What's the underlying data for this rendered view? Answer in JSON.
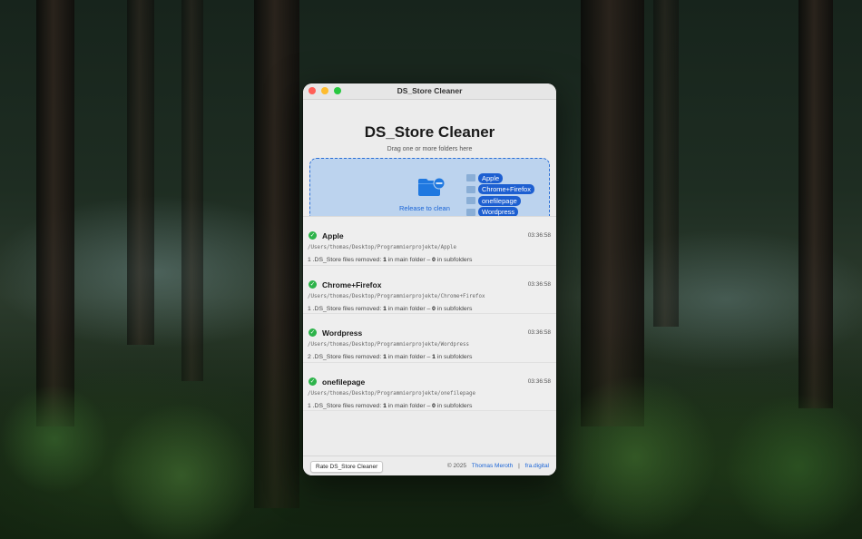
{
  "window": {
    "title": "DS_Store Cleaner"
  },
  "header": {
    "title": "DS_Store Cleaner",
    "drag_hint": "Drag one or more folders here"
  },
  "dropzone": {
    "release_label": "Release to clean",
    "dragged_items": [
      "Apple",
      "Chrome+Firefox",
      "onefilepage",
      "Wordpress"
    ],
    "badge_count": "4"
  },
  "results": [
    {
      "name": "Apple",
      "time": "03:36:58",
      "path": "/Users/thomas/Desktop/Programmierprojekte/Apple",
      "total": "1",
      "main": "1",
      "sub": "0"
    },
    {
      "name": "Chrome+Firefox",
      "time": "03:36:58",
      "path": "/Users/thomas/Desktop/Programmierprojekte/Chrome+Firefox",
      "total": "1",
      "main": "1",
      "sub": "0"
    },
    {
      "name": "Wordpress",
      "time": "03:36:58",
      "path": "/Users/thomas/Desktop/Programmierprojekte/Wordpress",
      "total": "2",
      "main": "1",
      "sub": "1"
    },
    {
      "name": "onefilepage",
      "time": "03:36:58",
      "path": "/Users/thomas/Desktop/Programmierprojekte/onefilepage",
      "total": "1",
      "main": "1",
      "sub": "0"
    }
  ],
  "summary_text": {
    "files_removed": " .DS_Store files removed: ",
    "in_main": " in main folder – ",
    "in_sub": " in subfolders"
  },
  "footer": {
    "rate_button": "Rate DS_Store Cleaner",
    "copyright": "© 2025",
    "author": "Thomas Meroth",
    "separator": "|",
    "website": "fra.digital"
  },
  "colors": {
    "accent": "#1d5fd1",
    "success": "#2db34a",
    "badge": "#e53935",
    "dropzone_bg": "#bcd3ee"
  }
}
